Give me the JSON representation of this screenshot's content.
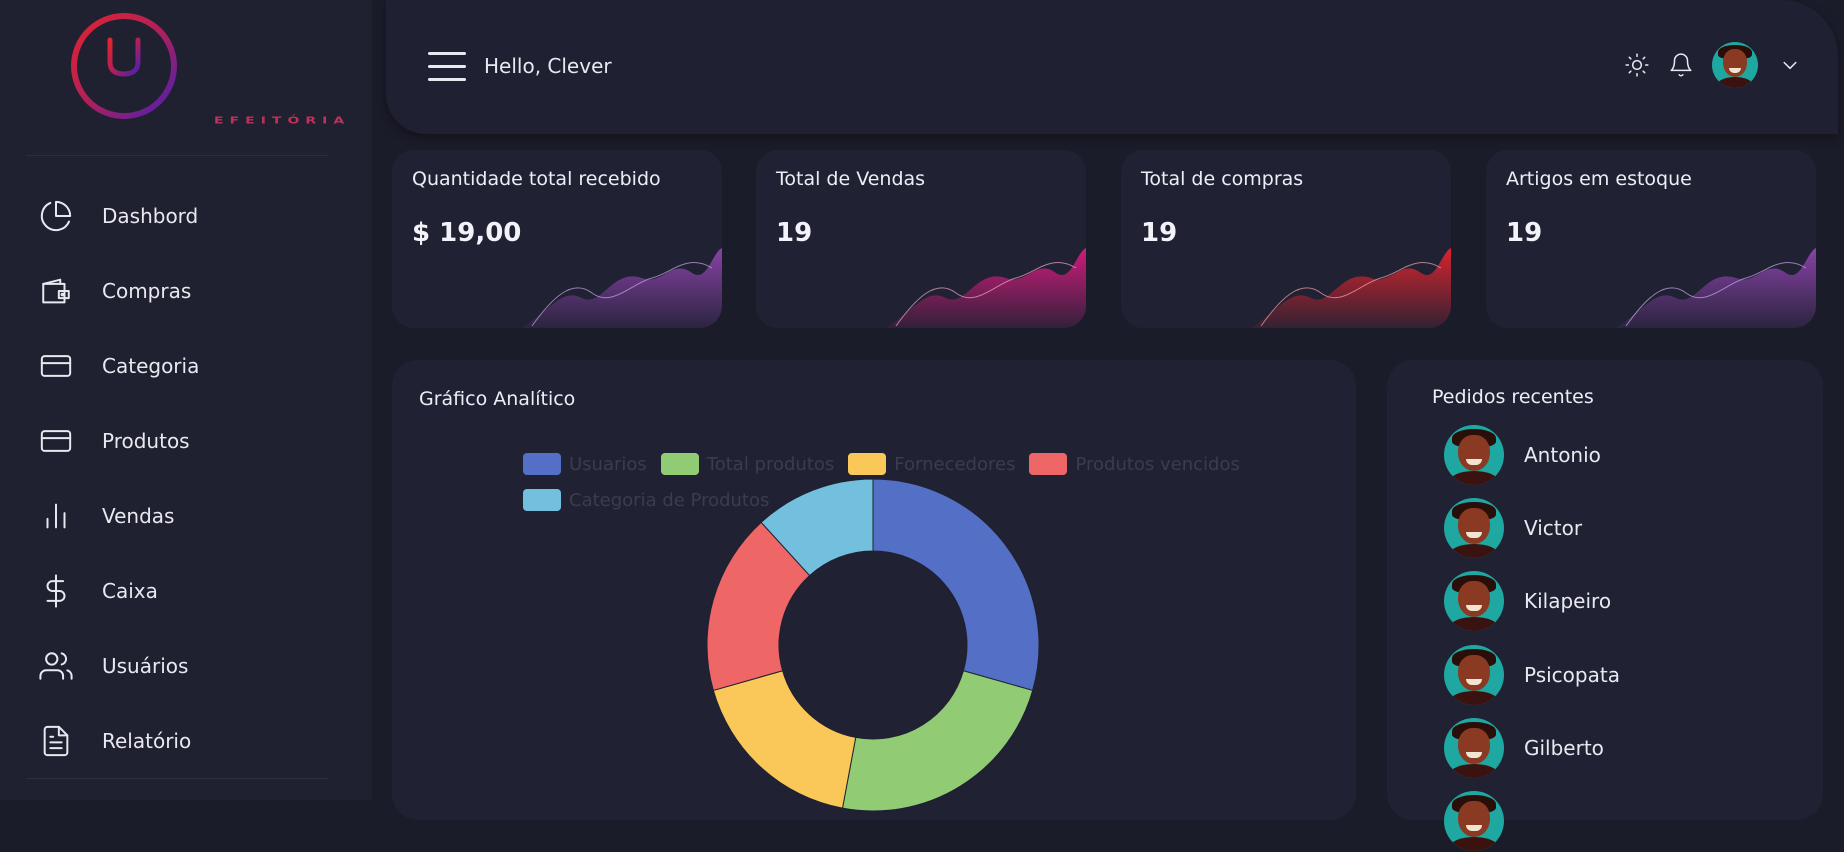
{
  "brand": {
    "logo_text": "EFEITÓRIA"
  },
  "sidebar": {
    "items": [
      {
        "label": "Dashbord",
        "icon": "pie-chart-icon"
      },
      {
        "label": "Compras",
        "icon": "wallet-icon"
      },
      {
        "label": "Categoria",
        "icon": "credit-card-icon"
      },
      {
        "label": "Produtos",
        "icon": "credit-card-icon"
      },
      {
        "label": "Vendas",
        "icon": "bar-chart-icon"
      },
      {
        "label": "Caixa",
        "icon": "dollar-icon"
      },
      {
        "label": "Usuários",
        "icon": "users-icon"
      },
      {
        "label": "Relatório",
        "icon": "file-text-icon"
      }
    ]
  },
  "header": {
    "greeting": "Hello, Clever",
    "icons": [
      "menu-icon",
      "sun-icon",
      "bell-icon",
      "avatar",
      "chevron-down-icon"
    ]
  },
  "cards": [
    {
      "title": "Quantidade total recebido",
      "value": "$ 19,00",
      "color": "#8e44ad"
    },
    {
      "title": "Total de Vendas",
      "value": "19",
      "color": "#d81b7f"
    },
    {
      "title": "Total de compras",
      "value": "19",
      "color": "#e0242e"
    },
    {
      "title": "Artigos em estoque",
      "value": "19",
      "color": "#8e44ad"
    }
  ],
  "analytics": {
    "title": "Gráfico Analítico"
  },
  "chart_data": {
    "type": "pie",
    "categories": [
      "Usuarios",
      "Total produtos",
      "Fornecedores",
      "Produtos vencidos",
      "Categoria de Produtos"
    ],
    "values": [
      5,
      4,
      3,
      3,
      2
    ],
    "colors": [
      "#5470c6",
      "#91cc75",
      "#fac858",
      "#ee6666",
      "#73c0de"
    ],
    "legend": "top"
  },
  "orders": {
    "title": "Pedidos recentes",
    "items": [
      "Antonio",
      "Victor",
      "Kilapeiro",
      "Psicopata",
      "Gilberto"
    ]
  }
}
